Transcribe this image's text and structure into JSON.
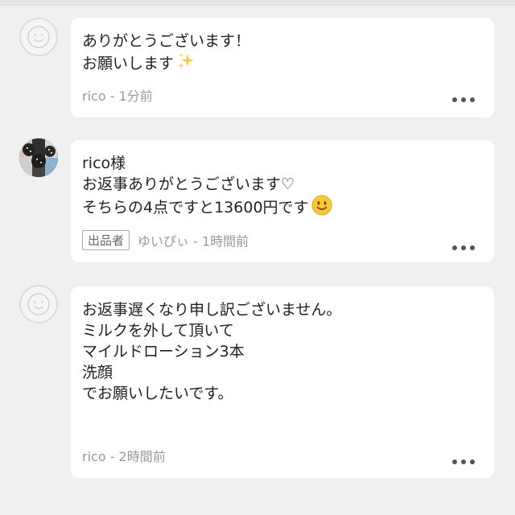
{
  "comments": [
    {
      "lines": [
        "ありがとうございます！",
        "お願いします"
      ],
      "author": "rico",
      "time": "1分前",
      "meta": "rico - 1分前",
      "avatar_icon": "default-avatar-icon",
      "emoji_icon": "sparkles-icon"
    },
    {
      "lines": [
        "rico様",
        "お返事ありがとうございます♡",
        "そちらの4点ですと13600円です"
      ],
      "badge": "出品者",
      "author": "ゆいぴぃ",
      "time": "1時間前",
      "meta": "ゆいぴぃ - 1時間前",
      "avatar_icon": "profile-photo-avatar",
      "emoji_icon": "smiley-face-icon"
    },
    {
      "lines": [
        "お返事遅くなり申し訳ございません。",
        "ミルクを外して頂いて",
        "マイルドローション3本",
        "洗顔",
        "でお願いしたいです。"
      ],
      "author": "rico",
      "time": "2時間前",
      "meta": "rico - 2時間前",
      "avatar_icon": "default-avatar-icon"
    }
  ],
  "colors": {
    "background": "#f0f0f0",
    "bubble": "#ffffff",
    "text": "#222222",
    "meta": "#999999",
    "dots": "#555555"
  },
  "more_icon": "more-options-icon"
}
